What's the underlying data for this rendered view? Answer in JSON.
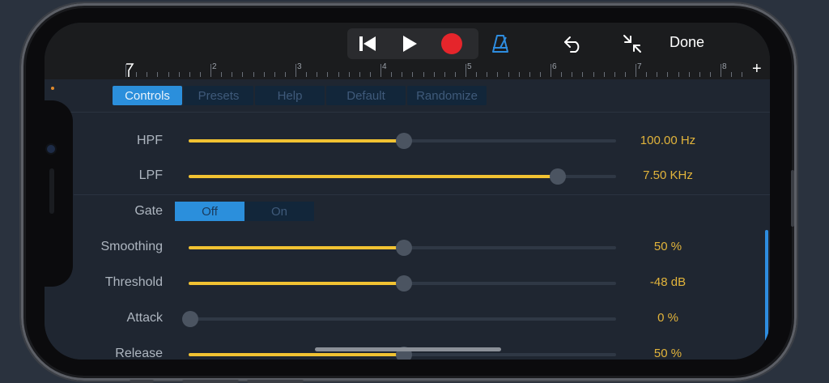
{
  "toolbar": {
    "icons": [
      "skip-back-icon",
      "play-icon",
      "record-icon",
      "metronome-icon",
      "undo-icon",
      "collapse-icon"
    ],
    "done_label": "Done",
    "record_color": "#e5252b",
    "metronome_color": "#2e8de0"
  },
  "ruler": {
    "numbers": [
      "2",
      "3",
      "4",
      "5",
      "6",
      "7",
      "8"
    ],
    "add_label": "+"
  },
  "tabs": [
    {
      "label": "Controls",
      "active": true
    },
    {
      "label": "Presets",
      "active": false
    },
    {
      "label": "Help",
      "active": false
    },
    {
      "label": "Default",
      "active": false
    },
    {
      "label": "Randomize",
      "active": false
    }
  ],
  "controls": {
    "hpf": {
      "label": "HPF",
      "value": "100.00 Hz",
      "level": 0.5
    },
    "lpf": {
      "label": "LPF",
      "value": "7.50 KHz",
      "level": 0.86
    },
    "gate": {
      "label": "Gate",
      "options": [
        "Off",
        "On"
      ],
      "selected": "Off"
    },
    "smoothing": {
      "label": "Smoothing",
      "value": "50 %",
      "level": 0.5
    },
    "threshold": {
      "label": "Threshold",
      "value": "-48 dB",
      "level": 0.5
    },
    "attack": {
      "label": "Attack",
      "value": "0 %",
      "level": 0.0
    },
    "release": {
      "label": "Release",
      "value": "50 %",
      "level": 0.5
    }
  },
  "colors": {
    "accent": "#2b8fdc",
    "slider_fill": "#f1c232",
    "value_text": "#e2b43b"
  }
}
